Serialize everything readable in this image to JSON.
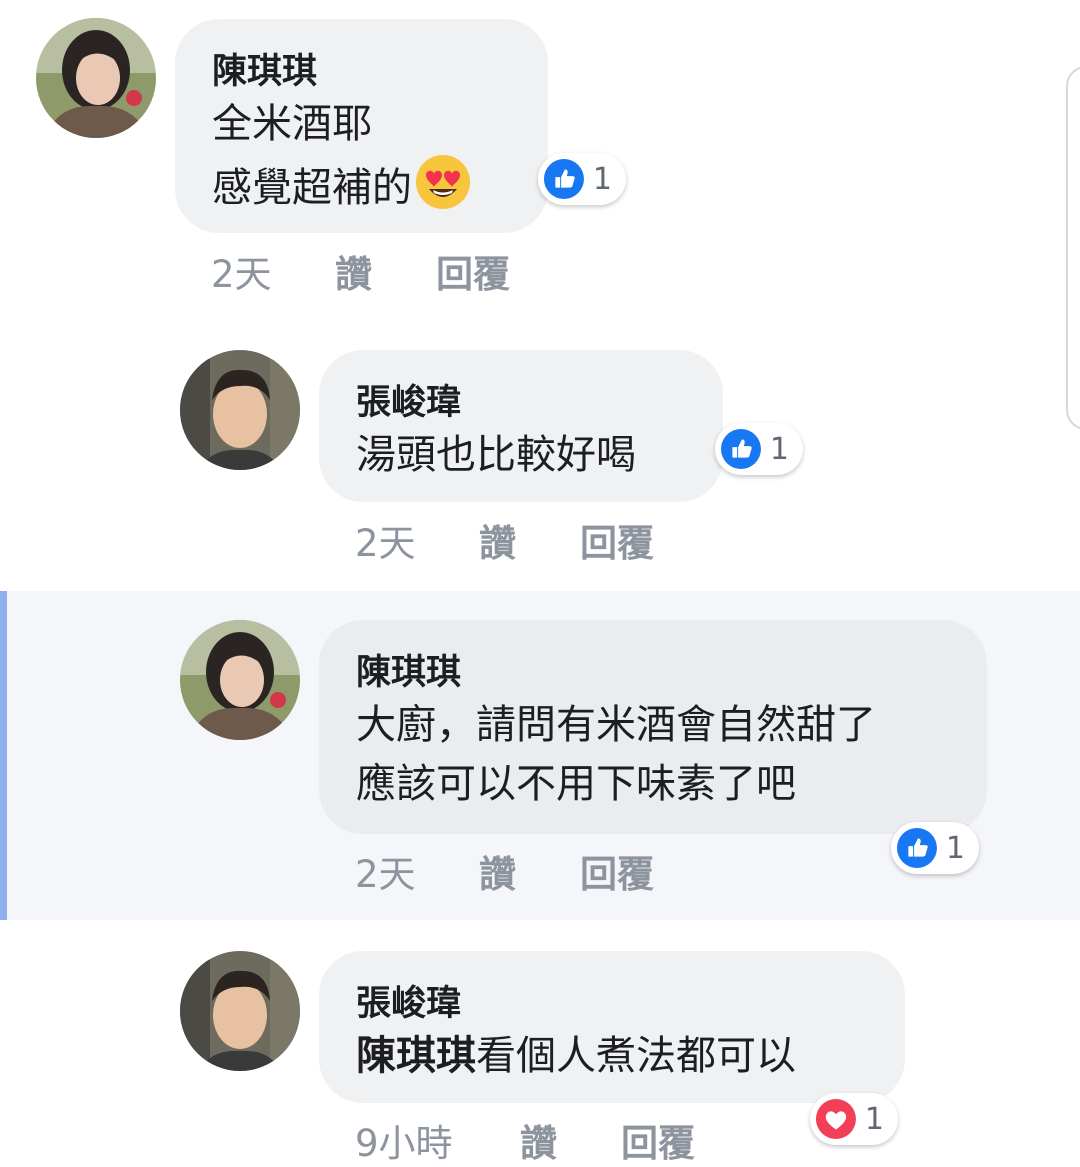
{
  "comments": [
    {
      "author": "陳琪琪",
      "lines": [
        "全米酒耶",
        "感覺超補的"
      ],
      "emoji": "heart-eyes-emoji",
      "reaction": {
        "type": "like",
        "count": "1"
      },
      "time": "2天",
      "like_label": "讚",
      "reply_label": "回覆"
    },
    {
      "author": "張峻瑋",
      "lines": [
        "湯頭也比較好喝"
      ],
      "reaction": {
        "type": "like",
        "count": "1"
      },
      "time": "2天",
      "like_label": "讚",
      "reply_label": "回覆"
    },
    {
      "author": "陳琪琪",
      "lines": [
        "大廚，請問有米酒會自然甜了",
        "應該可以不用下味素了吧"
      ],
      "reaction": {
        "type": "like",
        "count": "1"
      },
      "time": "2天",
      "like_label": "讚",
      "reply_label": "回覆",
      "highlighted": true
    },
    {
      "author": "張峻瑋",
      "mention": "陳琪琪",
      "line_rest": "看個人煮法都可以",
      "reaction": {
        "type": "love",
        "count": "1"
      },
      "time": "9小時",
      "like_label": "讚",
      "reply_label": "回覆"
    }
  ],
  "colors": {
    "like_blue": "#1877f2",
    "love_red": "#f33e58",
    "bubble_bg": "#f0f1f3",
    "meta_gray": "#8d949e",
    "highlight_bar": "#8fb0f0"
  }
}
